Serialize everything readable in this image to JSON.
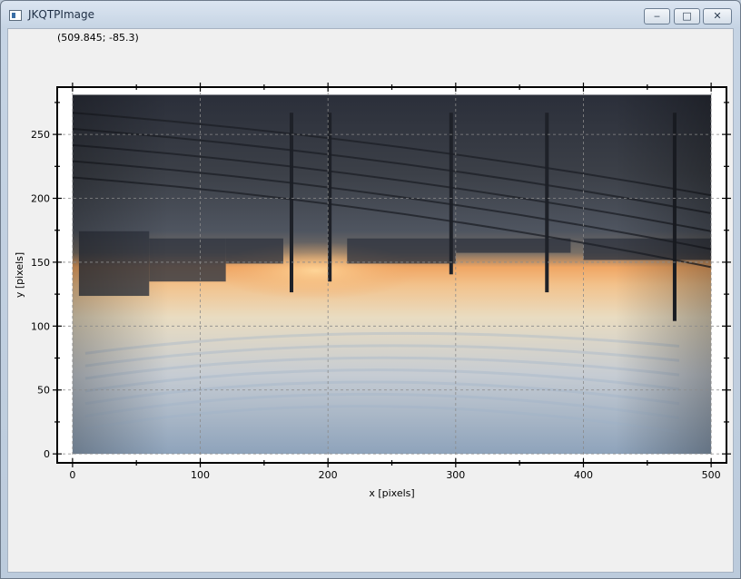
{
  "window": {
    "title": "JKQTPImage",
    "minimize_glyph": "‒",
    "maximize_glyph": "□",
    "close_glyph": "✕",
    "icon": "window-app-icon"
  },
  "status": {
    "coordinates": "(509.845; -85.3)"
  },
  "chart_data": {
    "type": "image",
    "xlabel": "x [pixels]",
    "ylabel": "y [pixels]",
    "xlim": [
      -12,
      512
    ],
    "ylim": [
      -7,
      287
    ],
    "x_ticks": [
      0,
      100,
      200,
      300,
      400,
      500
    ],
    "y_ticks": [
      0,
      50,
      100,
      150,
      200,
      250
    ],
    "image_extent": {
      "x": [
        0,
        500
      ],
      "y": [
        0,
        281
      ]
    },
    "image_description_colors": {
      "sky_light": "#e8dcc2",
      "sky_blue": "#9fb2c8",
      "sunset_orange": "#f2a865",
      "dark_structure": "#2f3440"
    }
  }
}
